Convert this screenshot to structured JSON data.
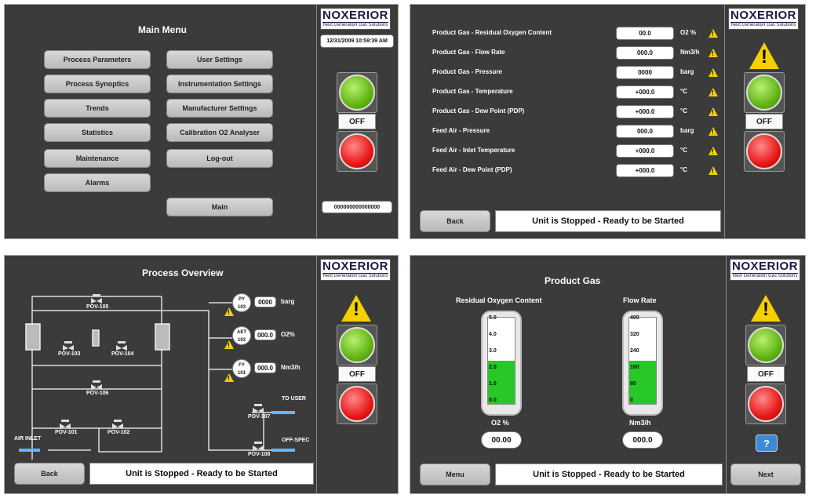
{
  "logo": {
    "brand": "NOXERIOR",
    "tagline": "Next Generation Gas Solutions"
  },
  "main_menu": {
    "title": "Main Menu",
    "datetime": "12/31/2009 10:59:39 AM",
    "left_buttons": [
      "Process Parameters",
      "Process Synoptics",
      "Trends",
      "Statistics",
      "Maintenance",
      "Alarms"
    ],
    "right_buttons": [
      "User Settings",
      "Instrumentation Settings",
      "Manufacturer Settings",
      "Calibration O2 Analyser",
      "Log-out"
    ],
    "main_button": "Main",
    "off_label": "OFF",
    "code": "000000000000000"
  },
  "params": {
    "rows": [
      {
        "label": "Product Gas - Residual Oxygen Content",
        "value": "00.0",
        "unit": "O2 %"
      },
      {
        "label": "Product Gas - Flow Rate",
        "value": "000.0",
        "unit": "Nm3/h"
      },
      {
        "label": "Product Gas - Pressure",
        "value": "0000",
        "unit": "barg"
      },
      {
        "label": "Product Gas - Temperature",
        "value": "+000.0",
        "unit": "°C"
      },
      {
        "label": "Product Gas - Dew Point (PDP)",
        "value": "+000.0",
        "unit": "°C"
      },
      {
        "label": "Feed Air - Pressure",
        "value": "000.0",
        "unit": "barg"
      },
      {
        "label": "Feed Air - Inlet Temperature",
        "value": "+000.0",
        "unit": "°C"
      },
      {
        "label": "Feed Air - Dew Point (PDP)",
        "value": "+000.0",
        "unit": "°C"
      }
    ],
    "back_label": "Back",
    "status": "Unit is Stopped - Ready to be Started",
    "off_label": "OFF"
  },
  "overview": {
    "title": "Process Overview",
    "valves": [
      "POV-105",
      "POV-103",
      "POV-104",
      "POV-106",
      "POV-101",
      "POV-102",
      "POV-107",
      "POV-108"
    ],
    "instruments": [
      {
        "tag": "PY",
        "num": "103",
        "value": "0000",
        "unit": "barg"
      },
      {
        "tag": "AET",
        "num": "103",
        "value": "000.0",
        "unit": "O2%"
      },
      {
        "tag": "FY",
        "num": "101",
        "value": "000.0",
        "unit": "Nm3/h"
      }
    ],
    "air_inlet": "AIR INLET",
    "to_user": "TO USER",
    "off_spec": "OFF-SPEC",
    "back_label": "Back",
    "status": "Unit is Stopped - Ready to be Started",
    "off_label": "OFF"
  },
  "product": {
    "title": "Product Gas",
    "gauge1": {
      "label": "Residual Oxygen Content",
      "ticks": [
        "5.0",
        "4.0",
        "3.0",
        "2.0",
        "1.0",
        "0.0"
      ],
      "unit": "O2 %",
      "value": "00.00",
      "fill": 0.5
    },
    "gauge2": {
      "label": "Flow Rate",
      "ticks": [
        "400",
        "320",
        "240",
        "160",
        "80",
        "0"
      ],
      "unit": "Nm3/h",
      "value": "000.0",
      "fill": 0.5
    },
    "menu_label": "Menu",
    "next_label": "Next",
    "status": "Unit is Stopped - Ready to be Started",
    "off_label": "OFF"
  }
}
